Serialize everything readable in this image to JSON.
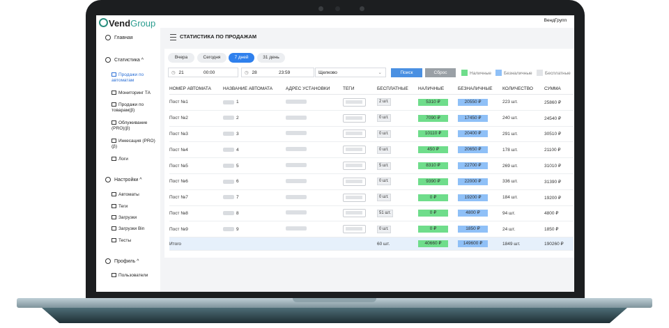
{
  "app": {
    "logo_vend": "Vend",
    "logo_group": "Group",
    "user": "ВендГрупп"
  },
  "sidebar": {
    "home": "Главная",
    "stats": "Статистика",
    "stats_items": [
      "Продажи по автоматам",
      "Мониторинг ТА",
      "Продажи по товарам(β)",
      "Облуживание (PRO)(β)",
      "Инкесация (PRO)(β)",
      "Логи"
    ],
    "settings": "Настройки",
    "settings_items": [
      "Автоматы",
      "Теги",
      "Загрузки",
      "Загрузки Bin",
      "Тесты"
    ],
    "profile": "Профиль",
    "profile_items": [
      "Пользователи"
    ]
  },
  "page": {
    "title": "СТАТИСТИКА ПО ПРОДАЖАМ"
  },
  "filters": {
    "periods": [
      "Вчера",
      "Сегодня",
      "7 дней",
      "31 день"
    ],
    "active_period": "7 дней",
    "date_from": "21",
    "time_from": "00:00",
    "date_to": "28",
    "time_to": "23:59",
    "location": "Щелково",
    "search": "Поиск",
    "reset": "Сброс",
    "legend": [
      "Наличные",
      "Безналичные",
      "Бесплатные"
    ]
  },
  "colors": {
    "accent": "#2f80ed",
    "cash": "#6fdd8b",
    "card": "#8fc0f7",
    "search_btn": "#4a90e2",
    "reset_btn": "#9aa0a6"
  },
  "table": {
    "headers": [
      "НОМЕР АВТОМАТА",
      "НАЗВАНИЕ АВТОМАТА",
      "АДРЕС УСТАНОВКИ",
      "ТЕГИ",
      "БЕСПЛАТНЫЕ",
      "НАЛИЧНЫЕ",
      "БЕЗНАЛИЧНЫЕ",
      "КОЛИЧЕСТВО",
      "СУММА"
    ],
    "rows": [
      {
        "num": "Пост №1",
        "name": "1",
        "free": "2 шт.",
        "cash": "5310 ₽",
        "card": "20550 ₽",
        "qty": "223 шт.",
        "sum": "25860 ₽"
      },
      {
        "num": "Пост №2",
        "name": "2",
        "free": "0 шт.",
        "cash": "7090 ₽",
        "card": "17450 ₽",
        "qty": "240 шт.",
        "sum": "24540 ₽"
      },
      {
        "num": "Пост №3",
        "name": "3",
        "free": "0 шт.",
        "cash": "10110 ₽",
        "card": "20400 ₽",
        "qty": "291 шт.",
        "sum": "30510 ₽"
      },
      {
        "num": "Пост №4",
        "name": "4",
        "free": "0 шт.",
        "cash": "450 ₽",
        "card": "20650 ₽",
        "qty": "178 шт.",
        "sum": "21100 ₽"
      },
      {
        "num": "Пост №5",
        "name": "5",
        "free": "5 шт.",
        "cash": "8310 ₽",
        "card": "22700 ₽",
        "qty": "269 шт.",
        "sum": "31010 ₽"
      },
      {
        "num": "Пост №6",
        "name": "6",
        "free": "0 шт.",
        "cash": "9390 ₽",
        "card": "22000 ₽",
        "qty": "336 шт.",
        "sum": "31390 ₽"
      },
      {
        "num": "Пост №7",
        "name": "7",
        "free": "0 шт.",
        "cash": "0 ₽",
        "card": "19200 ₽",
        "qty": "184 шт.",
        "sum": "19200 ₽"
      },
      {
        "num": "Пост №8",
        "name": "8",
        "free": "51 шт.",
        "cash": "0 ₽",
        "card": "4800 ₽",
        "qty": "94 шт.",
        "sum": "4800 ₽"
      },
      {
        "num": "Пост №9",
        "name": "9",
        "free": "0 шт.",
        "cash": "0 ₽",
        "card": "1850 ₽",
        "qty": "24 шт.",
        "sum": "1850 ₽"
      }
    ],
    "total": {
      "label": "Итого",
      "free": "60 шт.",
      "cash": "40660 ₽",
      "card": "149600 ₽",
      "qty": "1849 шт.",
      "sum": "190260 ₽"
    }
  }
}
